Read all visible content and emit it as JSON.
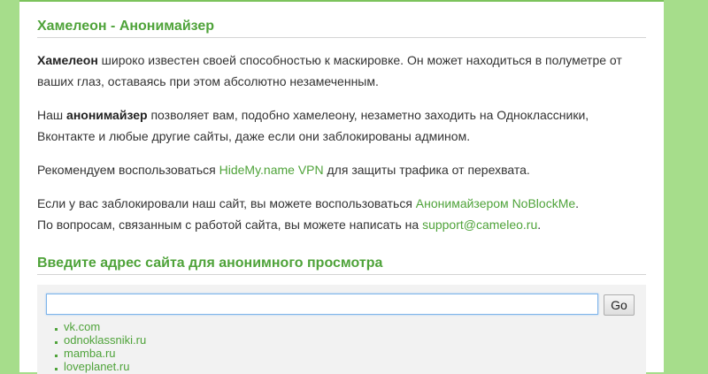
{
  "colors": {
    "background": "#a6dd8b",
    "accent_green": "#4fa33a",
    "text": "#333333",
    "panel": "#f2f2f2"
  },
  "intro": {
    "title": "Хамелеон - Анонимайзер",
    "p1": {
      "bold": "Хамелеон",
      "text": " широко известен своей способностью к маскировке. Он может находиться в полуметре от ваших глаз, оставаясь при этом абсолютно незамеченным."
    },
    "p2": {
      "before": "Наш ",
      "bold": "анонимайзер",
      "text": " позволяет вам, подобно хамелеону, незаметно заходить на Одноклассники, Вконтакте и любые другие сайты, даже если они заблокированы админом."
    },
    "p3": {
      "before": "Рекомендуем воспользоваться ",
      "link": "HideMy.name VPN",
      "after": " для защиты трафика от перехвата."
    },
    "p4": {
      "before": "Если у вас заблокировали наш сайт, вы можете воспользоваться ",
      "link": "Анонимайзером NoBlockMe",
      "after": "."
    },
    "p5": {
      "before": "По вопросам, связанным с работой сайта, вы можете написать на ",
      "link": "support@cameleo.ru",
      "after": "."
    }
  },
  "form": {
    "title": "Введите адрес сайта для анонимного просмотра",
    "input_value": "",
    "button_label": "Go",
    "sites": [
      "vk.com",
      "odnoklassniki.ru",
      "mamba.ru",
      "loveplanet.ru"
    ]
  }
}
